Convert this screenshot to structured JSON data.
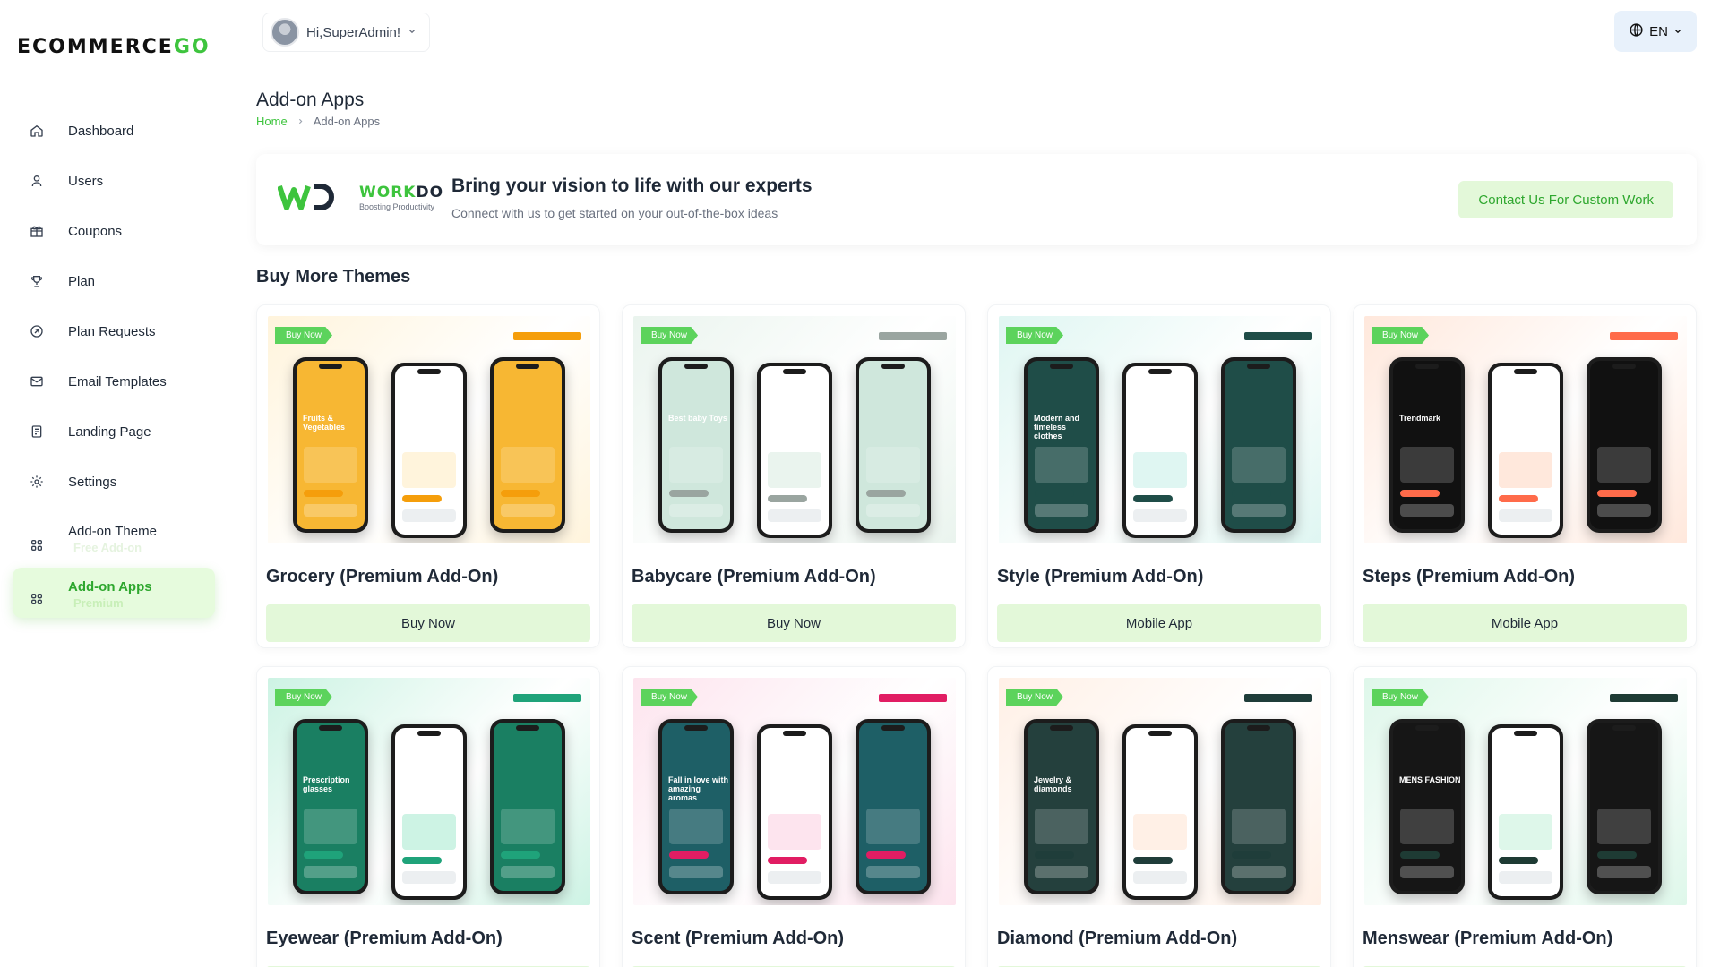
{
  "brand": {
    "logo_main": "ECOMMERCE",
    "logo_accent": "GO"
  },
  "sidebar": {
    "items": [
      {
        "label": "Dashboard",
        "icon": "home-icon"
      },
      {
        "label": "Users",
        "icon": "user-icon"
      },
      {
        "label": "Coupons",
        "icon": "gift-icon"
      },
      {
        "label": "Plan",
        "icon": "trophy-icon"
      },
      {
        "label": "Plan Requests",
        "icon": "request-icon"
      },
      {
        "label": "Email Templates",
        "icon": "mail-icon"
      },
      {
        "label": "Landing Page",
        "icon": "landing-icon"
      },
      {
        "label": "Settings",
        "icon": "gear-icon"
      },
      {
        "label": "Add-on Theme",
        "badge": "Free Add-on",
        "icon": "apps-icon"
      },
      {
        "label": "Add-on Apps",
        "badge": "Premium",
        "icon": "apps-icon",
        "active": true
      }
    ]
  },
  "topbar": {
    "greeting": "Hi,SuperAdmin!",
    "language": "EN"
  },
  "header": {
    "title": "Add-on Apps",
    "breadcrumb": [
      "Home",
      "Add-on Apps"
    ]
  },
  "banner": {
    "logo_name_w": "W",
    "logo_name_ork": "ORK",
    "logo_name_do": "DO",
    "logo_tagline": "Boosting Productivity",
    "title": "Bring your vision to life with our experts",
    "subtitle": "Connect with us to get started on your out-of-the-box ideas",
    "button": "Contact Us For Custom Work"
  },
  "section_title": "Buy More Themes",
  "themes": [
    {
      "title": "Grocery (Premium Add-On)",
      "button": "Buy Now",
      "badge": "Buy Now",
      "bg": "#fff4dc",
      "accent": "#f59e0b",
      "screen": "#f7b733",
      "phone_text": "Fruits & Vegetables"
    },
    {
      "title": "Babycare (Premium Add-On)",
      "button": "Buy Now",
      "badge": "Buy Now",
      "bg": "#eaf4ee",
      "accent": "#9aa5a0",
      "screen": "#cfe7dc",
      "phone_text": "Best baby Toys"
    },
    {
      "title": "Style (Premium Add-On)",
      "button": "Mobile App",
      "badge": "Buy Now",
      "bg": "#dff6f2",
      "accent": "#1f4d48",
      "screen": "#1f4d48",
      "phone_text": "Modern and timeless clothes"
    },
    {
      "title": "Steps (Premium Add-On)",
      "button": "Mobile App",
      "badge": "Buy Now",
      "bg": "#ffe8dc",
      "accent": "#ff6b4a",
      "screen": "#111111",
      "phone_text": "Trendmark"
    },
    {
      "title": "Eyewear (Premium Add-On)",
      "button": "",
      "badge": "Buy Now",
      "bg": "#cdf3e4",
      "accent": "#1fa37a",
      "screen": "#1a7f62",
      "phone_text": "Prescription glasses"
    },
    {
      "title": "Scent (Premium Add-On)",
      "button": "",
      "badge": "Buy Now",
      "bg": "#fde4ee",
      "accent": "#e11d63",
      "screen": "#1e5f66",
      "phone_text": "Fall in love with amazing aromas"
    },
    {
      "title": "Diamond (Premium Add-On)",
      "button": "",
      "badge": "Buy Now",
      "bg": "#fff0e6",
      "accent": "#1f3d3a",
      "screen": "#24403d",
      "phone_text": "Jewelry & diamonds"
    },
    {
      "title": "Menswear (Premium Add-On)",
      "button": "",
      "badge": "Buy Now",
      "bg": "#def7ea",
      "accent": "#1e3b34",
      "screen": "#161616",
      "phone_text": "MENS FASHION"
    }
  ]
}
